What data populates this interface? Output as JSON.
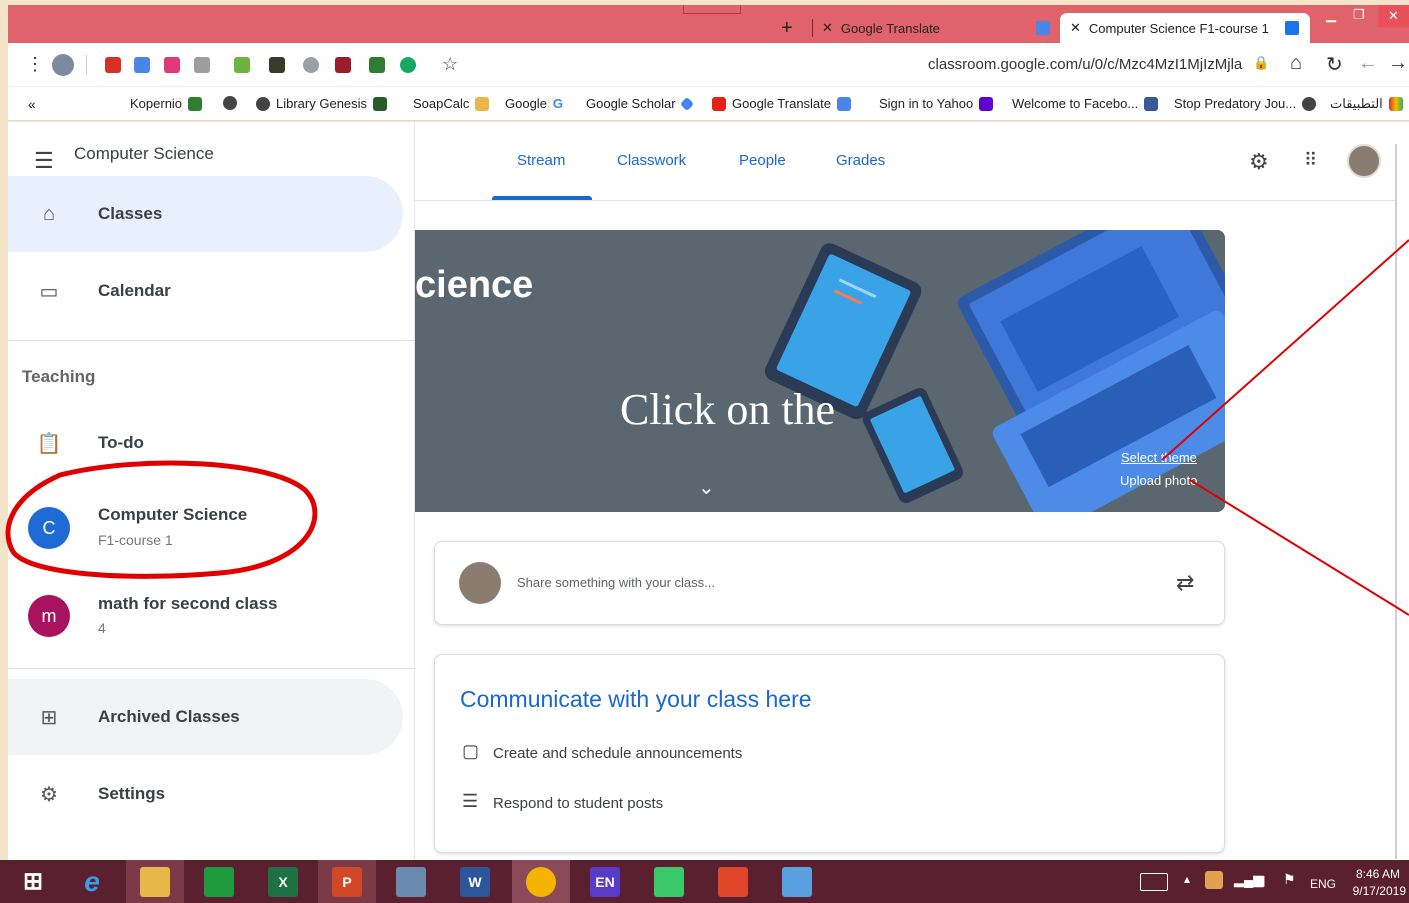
{
  "browser": {
    "tabs": [
      {
        "label": "Google Translate",
        "active": false
      },
      {
        "label": "Computer Science F1-course 1",
        "active": true
      }
    ],
    "new_tab": "+",
    "url": "classroom.google.com/u/0/c/Mzc4MzI1MjIzMjla",
    "bookmarks": [
      "Kopernio",
      "Library Genesis",
      "SoapCalc",
      "Google",
      "Google Scholar",
      "Google Translate",
      "Sign in to Yahoo",
      "Welcome to Facebo...",
      "Stop Predatory Jou...",
      "التطبيقات"
    ],
    "bookmarks_overflow": "«"
  },
  "app": {
    "title": "Computer Science",
    "tabs": [
      "Stream",
      "Classwork",
      "People",
      "Grades"
    ],
    "sidebar": {
      "classes": "Classes",
      "calendar": "Calendar",
      "teaching_header": "Teaching",
      "todo": "To-do",
      "class1": {
        "initial": "C",
        "name": "Computer Science",
        "section": "F1-course 1"
      },
      "class2": {
        "initial": "m",
        "name": "math for second class",
        "section": "4"
      },
      "archived": "Archived Classes",
      "settings": "Settings"
    },
    "banner": {
      "title": "cience",
      "overlay_text": "Click on the",
      "select_theme": "Select theme",
      "upload_photo": "Upload photo"
    },
    "share_placeholder": "Share something with your class...",
    "communicate": {
      "heading": "Communicate with your class here",
      "item1": "Create and schedule announcements",
      "item2": "Respond to student posts"
    }
  },
  "taskbar": {
    "lang_pill": "EN",
    "lang": "ENG",
    "time": "8:46 AM",
    "date": "9/17/2019"
  },
  "colors": {
    "accent": "#1967d2",
    "class1": "#1e6bd6",
    "class2": "#a8125e",
    "annotation": "#e00000"
  }
}
